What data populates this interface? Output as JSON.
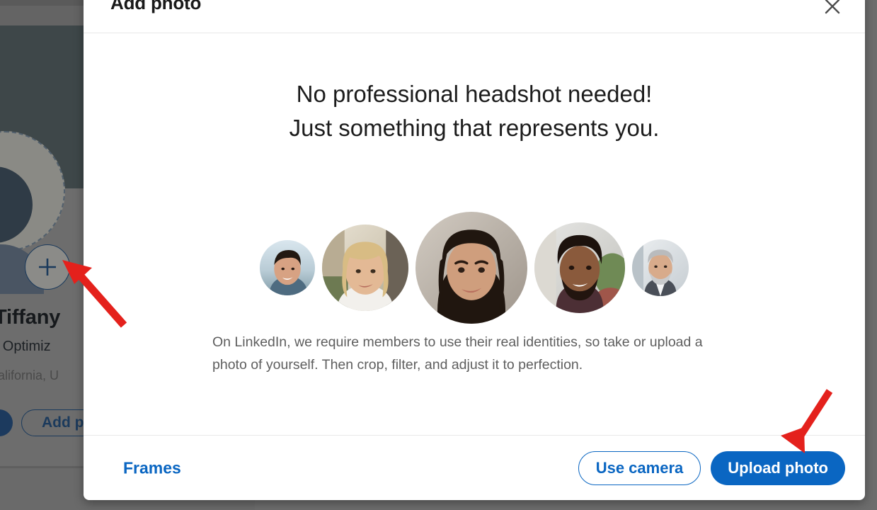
{
  "background_page": {
    "profile_name": "Tiffany",
    "profile_headline": "ne Optimiz",
    "profile_location": "California, U",
    "add_profile_button_label": "Add p",
    "add_photo_plus_icon": "plus-icon"
  },
  "modal": {
    "title": "Add photo",
    "close_icon": "close-icon",
    "headline_line1": "No professional headshot needed!",
    "headline_line2": "Just something that represents you.",
    "body_text": "On LinkedIn, we require members to use their real identities, so take or upload a photo of yourself. Then crop, filter, and adjust it to perfection.",
    "avatars": [
      {
        "name": "avatar-sample-1",
        "size": 78,
        "alt": "Smiling man with dark hair outdoors"
      },
      {
        "name": "avatar-sample-2",
        "size": 122,
        "alt": "Smiling woman with blonde hair"
      },
      {
        "name": "avatar-sample-3",
        "size": 158,
        "alt": "Smiling woman with long dark hair"
      },
      {
        "name": "avatar-sample-4",
        "size": 128,
        "alt": "Smiling man with beard"
      },
      {
        "name": "avatar-sample-5",
        "size": 80,
        "alt": "Smiling older man with grey beard in suit"
      }
    ],
    "footer": {
      "frames_label": "Frames",
      "use_camera_label": "Use camera",
      "upload_photo_label": "Upload photo"
    }
  },
  "annotations": {
    "arrow_color": "#e4211c",
    "arrows": [
      {
        "name": "arrow-pointing-to-add-photo-plus",
        "target": "add-photo-plus-button"
      },
      {
        "name": "arrow-pointing-to-upload-photo",
        "target": "upload-photo-button"
      }
    ]
  },
  "colors": {
    "brand_blue": "#0a66c2",
    "dark_navy": "#1b3a5c",
    "modal_bg": "#ffffff",
    "overlay_gray": "#6d6d6d",
    "cover_dark": "#3e4749",
    "arrow_red": "#e4211c"
  }
}
